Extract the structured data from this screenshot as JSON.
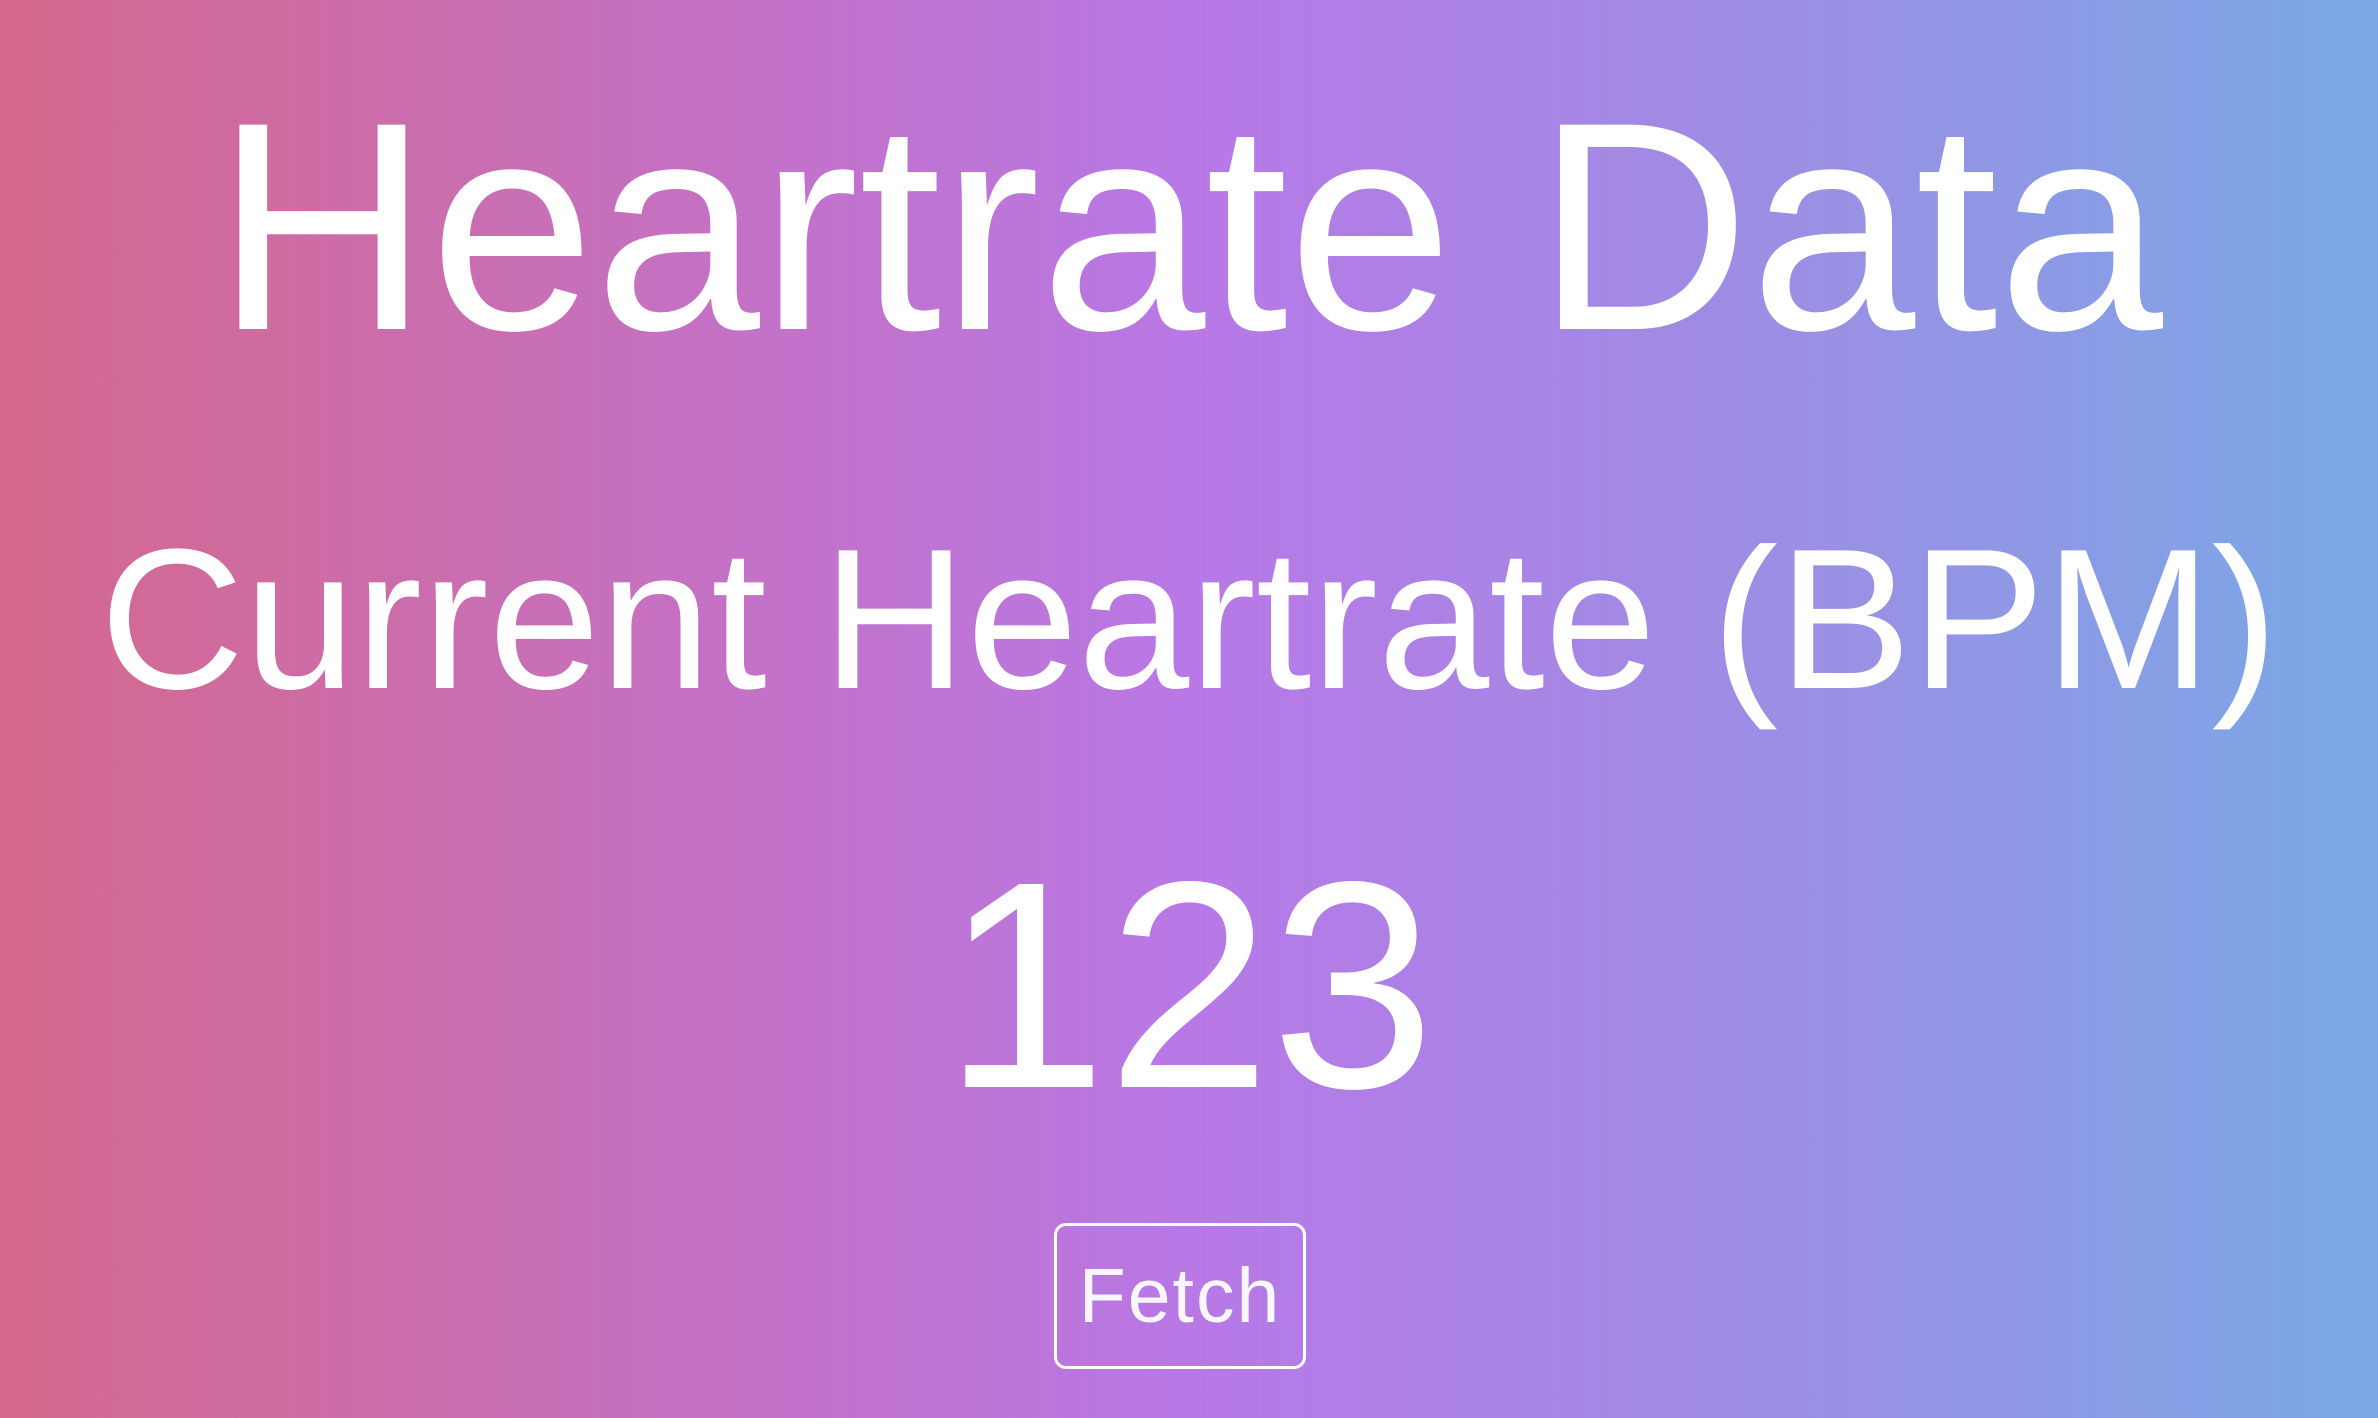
{
  "header": {
    "title": "Heartrate Data"
  },
  "main": {
    "label": "Current Heartrate (BPM)",
    "value": "123",
    "fetch_label": "Fetch"
  },
  "colors": {
    "gradient_left": "#d4688c",
    "gradient_mid": "#b878e6",
    "gradient_right": "#7aa8e6",
    "text": "#ffffff"
  }
}
